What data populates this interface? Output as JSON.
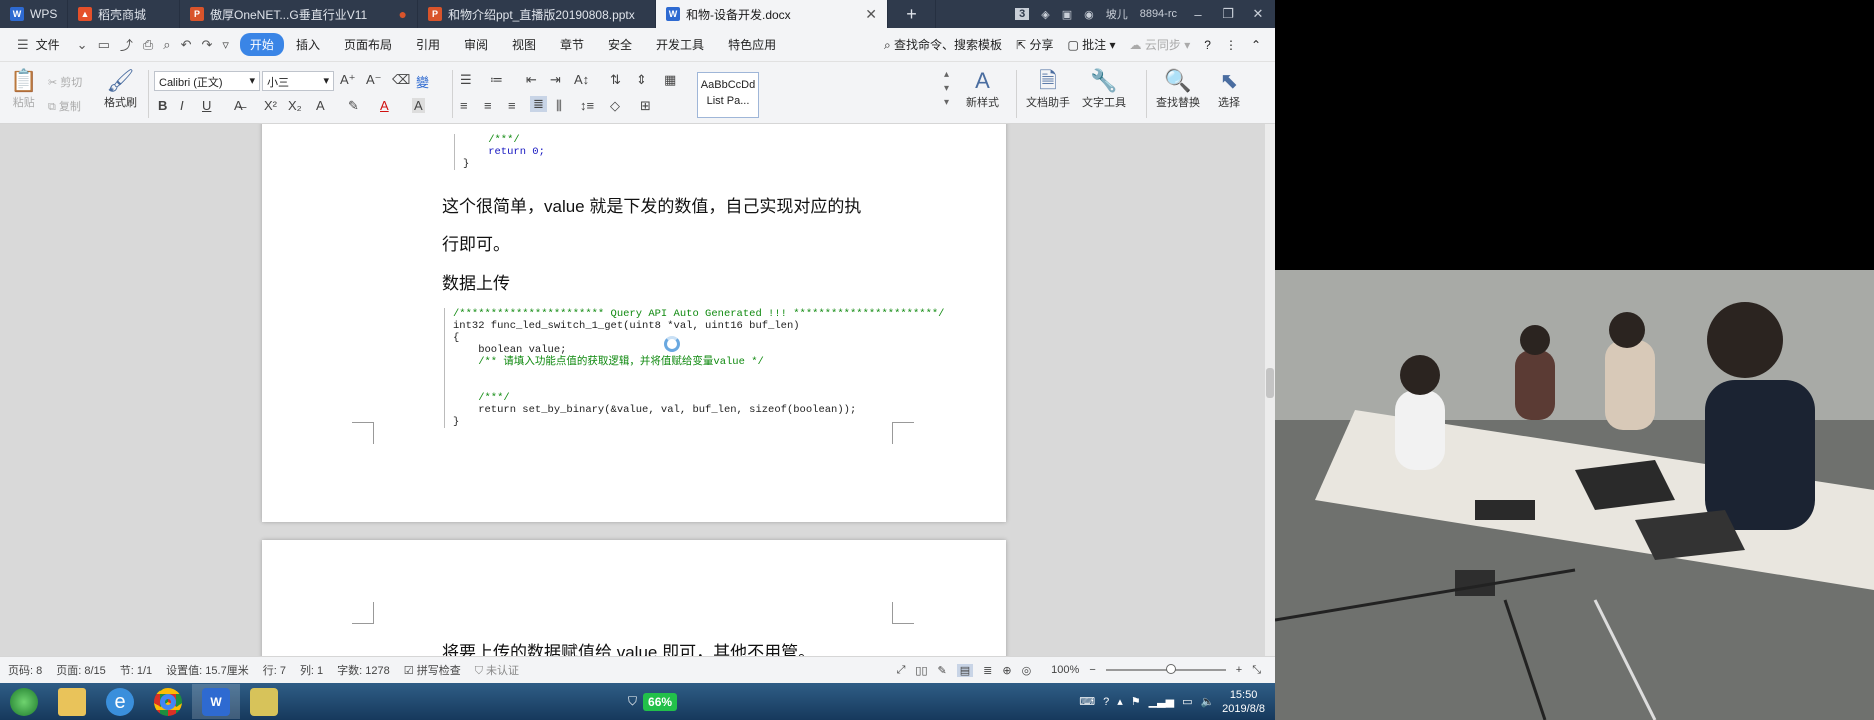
{
  "tabs": [
    {
      "label": "WPS",
      "color": "#2e6ad1"
    },
    {
      "label": "稻壳商城",
      "color": "#e5502a"
    },
    {
      "label": "傲厚OneNET...G垂直行业V11",
      "color": "#d9542b"
    },
    {
      "label": "和物介绍ppt_直播版20190808.pptx",
      "color": "#d9542b"
    },
    {
      "label": "和物-设备开发.docx",
      "color": "#2e6ad1"
    }
  ],
  "tabbar_right": {
    "badge": "3",
    "user": "坡儿",
    "code": "8894-rc"
  },
  "menu": {
    "file": "文件",
    "items": [
      "开始",
      "插入",
      "页面布局",
      "引用",
      "审阅",
      "视图",
      "章节",
      "安全",
      "开发工具",
      "特色应用"
    ],
    "search": "查找命令、搜索模板",
    "share": "分享",
    "comment": "批注",
    "sync": "云同步"
  },
  "ribbon": {
    "paste": "粘贴",
    "cut": "剪切",
    "copy": "复制",
    "format_painter": "格式刷",
    "font_name": "Calibri (正文)",
    "font_size": "小三",
    "style_preview": "AaBbCcDd",
    "style_name": "List Pa...",
    "new_style": "新样式",
    "doc_helper": "文档助手",
    "text_tools": "文字工具",
    "find_replace": "查找替换",
    "select": "选择"
  },
  "document": {
    "code_top": [
      "    /***/",
      "    return 0;",
      "}"
    ],
    "para1_line1": "这个很简单，value 就是下发的数值，自己实现对应的执",
    "para1_line2": "行即可。",
    "heading": "数据上传",
    "code_comment_line": "/*********************** Query API Auto Generated !!! ***********************/",
    "code_func": "int32 func_led_switch_1_get(uint8 *val, uint16 buf_len)",
    "code_brace_open": "{",
    "code_decl": "    boolean value;",
    "code_hint": "    /** 请填入功能点值的获取逻辑，并将值赋给变量value */",
    "code_mark": "    /***/",
    "code_return": "    return set_by_binary(&value, val, buf_len, sizeof(boolean));",
    "code_brace_close": "}",
    "page2_text": "将要上传的数据赋值给 value 即可，其他不用管。"
  },
  "status": {
    "page_num": "页码: 8",
    "pages": "页面: 8/15",
    "section": "节: 1/1",
    "setting": "设置值: 15.7厘米",
    "row": "行: 7",
    "col": "列: 1",
    "words": "字数: 1278",
    "spell": "拼写检查",
    "cert": "未认证",
    "zoom": "100%"
  },
  "taskbar": {
    "battery": "66%",
    "time": "15:50",
    "date": "2019/8/8"
  },
  "colors": {
    "accent": "#3a85e6",
    "tabbar_bg": "#2f3a4c",
    "code_comment": "#108a10",
    "code_keyword": "#1515c0"
  }
}
